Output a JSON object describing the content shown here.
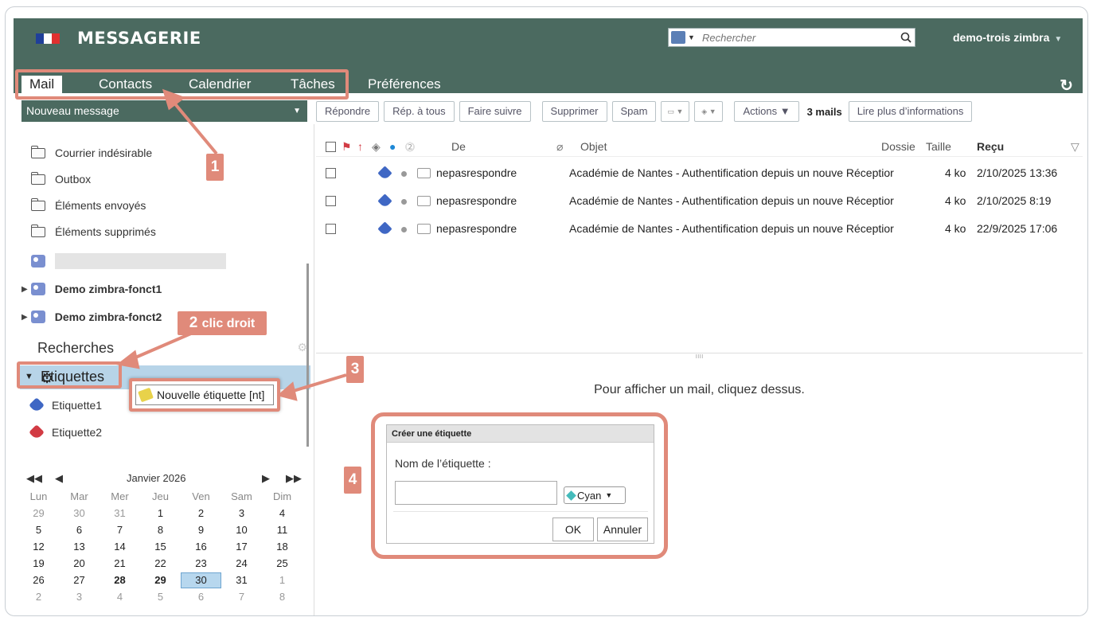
{
  "header": {
    "title": "MESSAGERIE",
    "search_placeholder": "Rechercher",
    "user": "demo-trois zimbra"
  },
  "nav": {
    "tabs": [
      "Mail",
      "Contacts",
      "Calendrier",
      "Tâches",
      "Préférences"
    ]
  },
  "new_message": "Nouveau message",
  "toolbar": {
    "reply": "Répondre",
    "reply_all": "Rép. à tous",
    "forward": "Faire suivre",
    "delete": "Supprimer",
    "spam": "Spam",
    "actions": "Actions",
    "count": "3 mails",
    "more_info": "Lire plus d’informations"
  },
  "folders": [
    "Courrier indésirable",
    "Outbox",
    "Éléments envoyés",
    "Éléments supprimés"
  ],
  "shared": [
    "Demo zimbra-fonct1",
    "Demo zimbra-fonct2"
  ],
  "sections": {
    "searches": "Recherches",
    "labels": "Etiquettes"
  },
  "labels": [
    {
      "name": "Etiquette1",
      "color": "#3f67c4"
    },
    {
      "name": "Etiquette2",
      "color": "#d23b44"
    }
  ],
  "list_columns": {
    "from": "De",
    "subject": "Objet",
    "folder": "Dossie",
    "size": "Taille",
    "received": "Reçu"
  },
  "messages": [
    {
      "from": "nepasrespondre",
      "subject": "Académie de Nantes - Authentification depuis un nouve",
      "folder": "Réceptior",
      "size": "4 ko",
      "date": "2/10/2025 13:36"
    },
    {
      "from": "nepasrespondre",
      "subject": "Académie de Nantes - Authentification depuis un nouve",
      "folder": "Réceptior",
      "size": "4 ko",
      "date": "2/10/2025 8:19"
    },
    {
      "from": "nepasrespondre",
      "subject": "Académie de Nantes - Authentification depuis un nouve",
      "folder": "Réceptior",
      "size": "4 ko",
      "date": "22/9/2025 17:06"
    }
  ],
  "reading_pane_hint": "Pour afficher un mail, cliquez dessus.",
  "context_menu": {
    "item": "Nouvelle étiquette [nt]"
  },
  "dialog": {
    "title": "Créer une étiquette",
    "label": "Nom de l’étiquette :",
    "color": "Cyan",
    "ok": "OK",
    "cancel": "Annuler"
  },
  "calendar": {
    "month": "Janvier 2026",
    "weekdays": [
      "Lun",
      "Mar",
      "Mer",
      "Jeu",
      "Ven",
      "Sam",
      "Dim"
    ],
    "weeks": [
      [
        "29",
        "30",
        "31",
        "1",
        "2",
        "3",
        "4"
      ],
      [
        "5",
        "6",
        "7",
        "8",
        "9",
        "10",
        "11"
      ],
      [
        "12",
        "13",
        "14",
        "15",
        "16",
        "17",
        "18"
      ],
      [
        "19",
        "20",
        "21",
        "22",
        "23",
        "24",
        "25"
      ],
      [
        "26",
        "27",
        "28",
        "29",
        "30",
        "31",
        "1"
      ],
      [
        "2",
        "3",
        "4",
        "5",
        "6",
        "7",
        "8"
      ]
    ],
    "selected": "30",
    "bold_days": [
      "28",
      "29"
    ]
  },
  "annotations": {
    "step1": "1",
    "step2": "2",
    "step2_text": "clic droit",
    "step3": "3",
    "step4": "4"
  },
  "colors": {
    "header_bg": "#4b6a60",
    "accent": "#e08a7a",
    "selected_label_bg": "#b7d4e8"
  }
}
